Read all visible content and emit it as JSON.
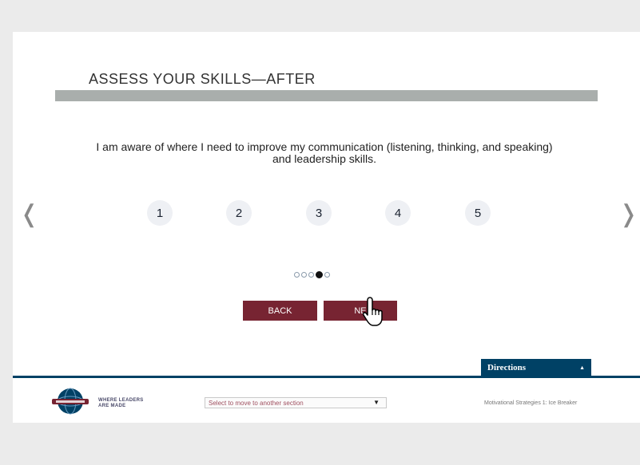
{
  "header": {
    "title": "ASSESS YOUR SKILLS—AFTER"
  },
  "question": {
    "text": "I am aware of where I need to improve my communication (listening, thinking, and speaking) and leadership skills."
  },
  "rating": {
    "options": [
      "1",
      "2",
      "3",
      "4",
      "5"
    ]
  },
  "navigation": {
    "prev_icon": "❬",
    "next_icon": "❭"
  },
  "pager": {
    "total": 5,
    "current": 4
  },
  "buttons": {
    "back_label": "BACK",
    "next_label": "NE"
  },
  "directions": {
    "label": "Directions",
    "arrow": "▲"
  },
  "footer": {
    "tagline_line1": "WHERE LEADERS",
    "tagline_line2": "ARE MADE",
    "section_select_value": "Select to move to another section",
    "section_select_caret": "▼",
    "course_name": "Motivational Strategies 1: Ice Breaker"
  },
  "colors": {
    "brand_maroon": "#772432",
    "brand_blue": "#004165",
    "title_bar": "#a9aeac"
  }
}
